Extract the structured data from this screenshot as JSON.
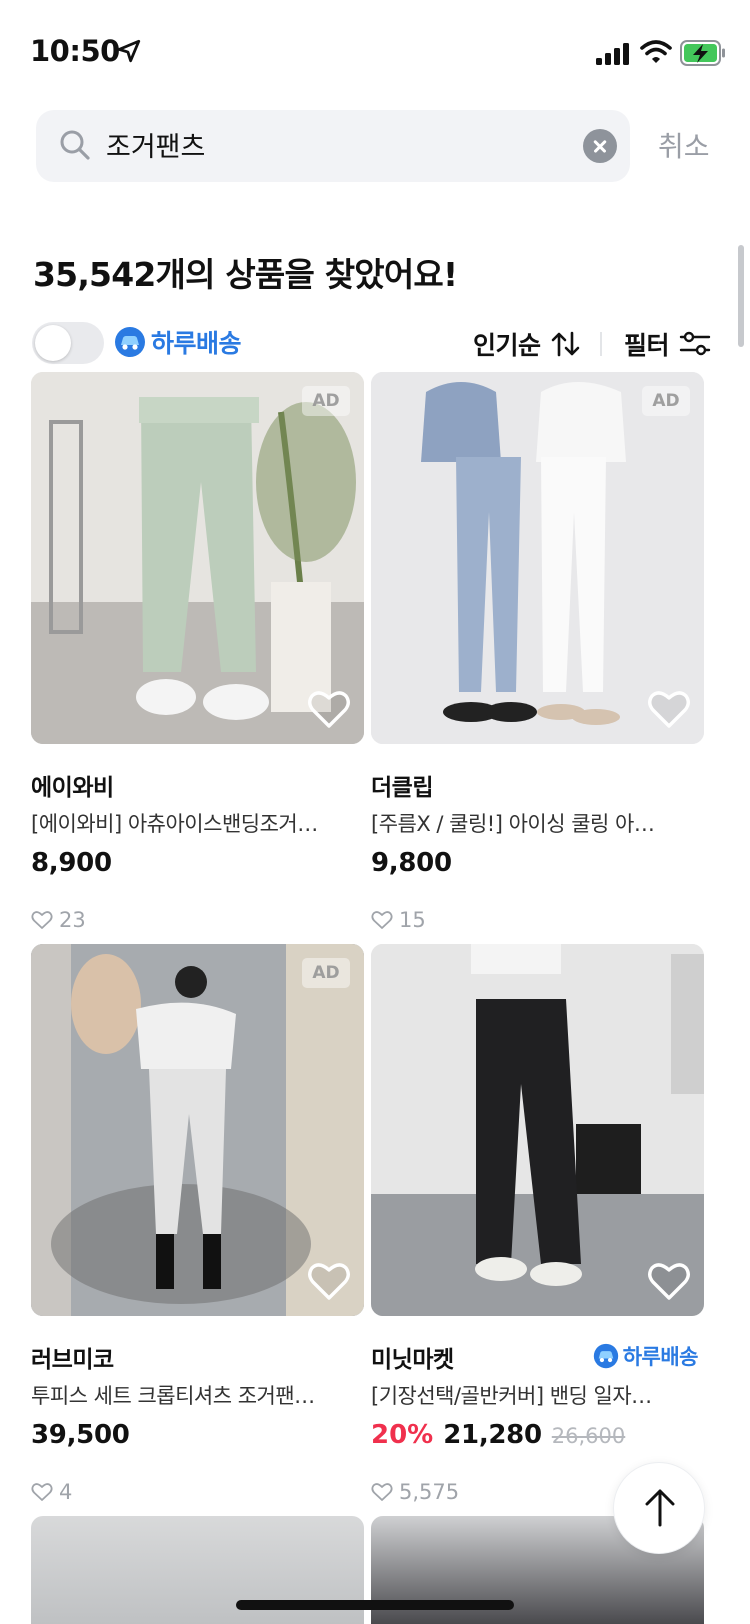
{
  "status": {
    "time": "10:50"
  },
  "search": {
    "query": "조거팬츠",
    "cancel_label": "취소"
  },
  "results": {
    "title": "35,542개의 상품을 찾았어요!",
    "fast_delivery_label": "하루배송",
    "fast_delivery_on": false,
    "sort_label": "인기순",
    "filter_label": "필터"
  },
  "products": [
    {
      "brand": "에이와비",
      "name": "[에이와비] 아츄아이스밴딩조거…",
      "price": "8,900",
      "likes": "23",
      "ad": "AD",
      "fast_delivery": false,
      "bg": [
        "#d7d5d1",
        "#bcc8bb"
      ]
    },
    {
      "brand": "더클립",
      "name": "[주름X / 쿨링!] 아이싱 쿨링 아…",
      "price": "9,800",
      "likes": "15",
      "ad": "AD",
      "fast_delivery": false,
      "bg": [
        "#e4e4e6",
        "#9fb1c9"
      ]
    },
    {
      "brand": "러브미코",
      "name": "투피스 세트 크롭티셔츠 조거팬…",
      "price": "39,500",
      "likes": "4",
      "ad": "AD",
      "fast_delivery": false,
      "bg": [
        "#a9adb1",
        "#d6d6d6"
      ]
    },
    {
      "brand": "미닛마켓",
      "name": "[기장선택/골반커버] 밴딩 일자…",
      "discount": "20%",
      "price": "21,280",
      "original_price": "26,600",
      "likes": "5,575",
      "fast_delivery": true,
      "fast_delivery_label": "하루배송",
      "bg": [
        "#e3e3e3",
        "#2b2b2e"
      ]
    }
  ],
  "colors": {
    "accent_blue": "#2a7ae2",
    "discount_red": "#f0304d"
  }
}
